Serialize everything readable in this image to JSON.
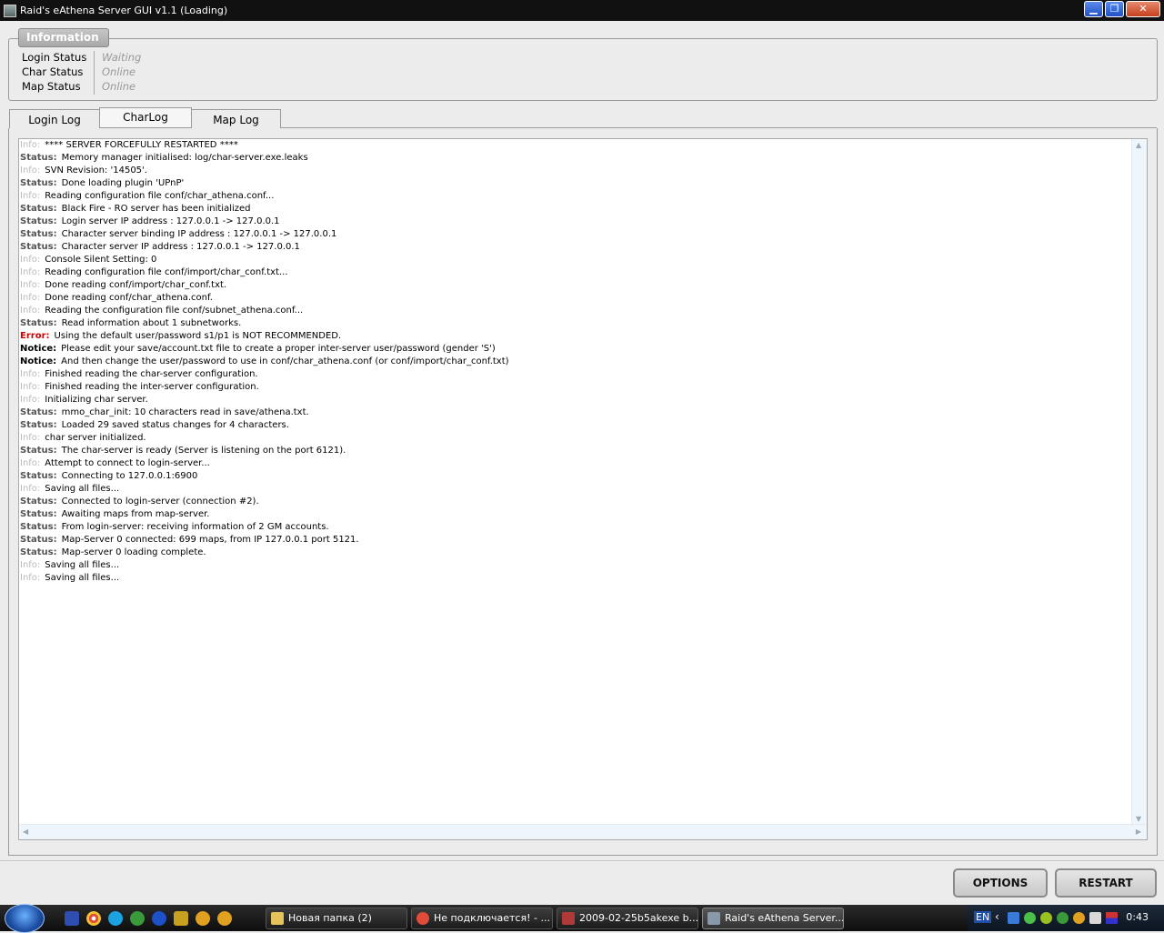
{
  "window": {
    "title": "Raid's eAthena Server GUI v1.1 (Loading)",
    "buttons": {
      "minimize": "▁",
      "maximize": "❐",
      "close": "✕"
    }
  },
  "info": {
    "legend": "Information",
    "rows": [
      {
        "label": "Login Status",
        "value": "Waiting"
      },
      {
        "label": "Char Status",
        "value": "Online"
      },
      {
        "label": "Map Status",
        "value": "Online"
      }
    ]
  },
  "tabs": [
    {
      "label": "Login Log",
      "active": false
    },
    {
      "label": "CharLog",
      "active": true
    },
    {
      "label": "Map Log",
      "active": false
    }
  ],
  "log": [
    {
      "level": "Info:",
      "type": "info",
      "text": "**** SERVER FORCEFULLY RESTARTED ****"
    },
    {
      "level": "Status:",
      "type": "status",
      "text": "Memory manager initialised: log/char-server.exe.leaks"
    },
    {
      "level": "Info:",
      "type": "info",
      "text": "SVN Revision: '14505'."
    },
    {
      "level": "Status:",
      "type": "status",
      "text": "Done loading plugin 'UPnP'"
    },
    {
      "level": "Info:",
      "type": "info",
      "text": "Reading configuration file conf/char_athena.conf..."
    },
    {
      "level": "Status:",
      "type": "status",
      "text": "Black Fire - RO server has been initialized"
    },
    {
      "level": "Status:",
      "type": "status",
      "text": "Login server IP address : 127.0.0.1 -> 127.0.0.1"
    },
    {
      "level": "Status:",
      "type": "status",
      "text": "Character server binding IP address : 127.0.0.1 -> 127.0.0.1"
    },
    {
      "level": "Status:",
      "type": "status",
      "text": "Character server IP address : 127.0.0.1 -> 127.0.0.1"
    },
    {
      "level": "Info:",
      "type": "info",
      "text": "Console Silent Setting: 0"
    },
    {
      "level": "Info:",
      "type": "info",
      "text": "Reading configuration file conf/import/char_conf.txt..."
    },
    {
      "level": "Info:",
      "type": "info",
      "text": "Done reading conf/import/char_conf.txt."
    },
    {
      "level": "Info:",
      "type": "info",
      "text": "Done reading conf/char_athena.conf."
    },
    {
      "level": "Info:",
      "type": "info",
      "text": "Reading the configuration file conf/subnet_athena.conf..."
    },
    {
      "level": "Status:",
      "type": "status",
      "text": "Read information about 1 subnetworks."
    },
    {
      "level": "Error:",
      "type": "error",
      "text": "Using the default user/password s1/p1 is NOT RECOMMENDED."
    },
    {
      "level": "Notice:",
      "type": "notice",
      "text": "Please edit your save/account.txt file to create a proper inter-server user/password (gender 'S')"
    },
    {
      "level": "Notice:",
      "type": "notice",
      "text": "And then change the user/password to use in conf/char_athena.conf (or conf/import/char_conf.txt)"
    },
    {
      "level": "Info:",
      "type": "info",
      "text": "Finished reading the char-server configuration."
    },
    {
      "level": "Info:",
      "type": "info",
      "text": "Finished reading the inter-server configuration."
    },
    {
      "level": "Info:",
      "type": "info",
      "text": "Initializing char server."
    },
    {
      "level": "Status:",
      "type": "status",
      "text": "mmo_char_init: 10 characters read in save/athena.txt."
    },
    {
      "level": "Status:",
      "type": "status",
      "text": "Loaded 29 saved status changes for 4 characters."
    },
    {
      "level": "Info:",
      "type": "info",
      "text": "char server initialized."
    },
    {
      "level": "Status:",
      "type": "status",
      "text": "The char-server is ready (Server is listening on the port 6121)."
    },
    {
      "level": "Info:",
      "type": "info",
      "text": "Attempt to connect to login-server..."
    },
    {
      "level": "Status:",
      "type": "status",
      "text": "Connecting to 127.0.0.1:6900"
    },
    {
      "level": "Info:",
      "type": "info",
      "text": "Saving all files..."
    },
    {
      "level": "Status:",
      "type": "status",
      "text": "Connected to login-server (connection #2)."
    },
    {
      "level": "Status:",
      "type": "status",
      "text": "Awaiting maps from map-server."
    },
    {
      "level": "Status:",
      "type": "status",
      "text": "From login-server: receiving information of 2 GM accounts."
    },
    {
      "level": "Status:",
      "type": "status",
      "text": "Map-Server 0 connected: 699 maps, from IP 127.0.0.1 port 5121."
    },
    {
      "level": "Status:",
      "type": "status",
      "text": "Map-server 0 loading complete."
    },
    {
      "level": "Info:",
      "type": "info",
      "text": "Saving all files..."
    },
    {
      "level": "Info:",
      "type": "info",
      "text": "Saving all files..."
    }
  ],
  "buttons": {
    "options": "OPTIONS",
    "restart": "RESTART"
  },
  "taskbar": {
    "tasks": [
      {
        "label": "Новая папка (2)",
        "icon": "folder-icon",
        "color": "#e6c35a",
        "active": false
      },
      {
        "label": "Не подключается! - ...",
        "icon": "chrome-icon",
        "color": "#e04b3a",
        "active": false
      },
      {
        "label": "2009-02-25b5akexe b...",
        "icon": "game-client-icon",
        "color": "#b03a3a",
        "active": false
      },
      {
        "label": "Raid's eAthena Server...",
        "icon": "server-gui-icon",
        "color": "#8899aa",
        "active": true
      }
    ],
    "language": "EN",
    "clock": "0:43"
  }
}
